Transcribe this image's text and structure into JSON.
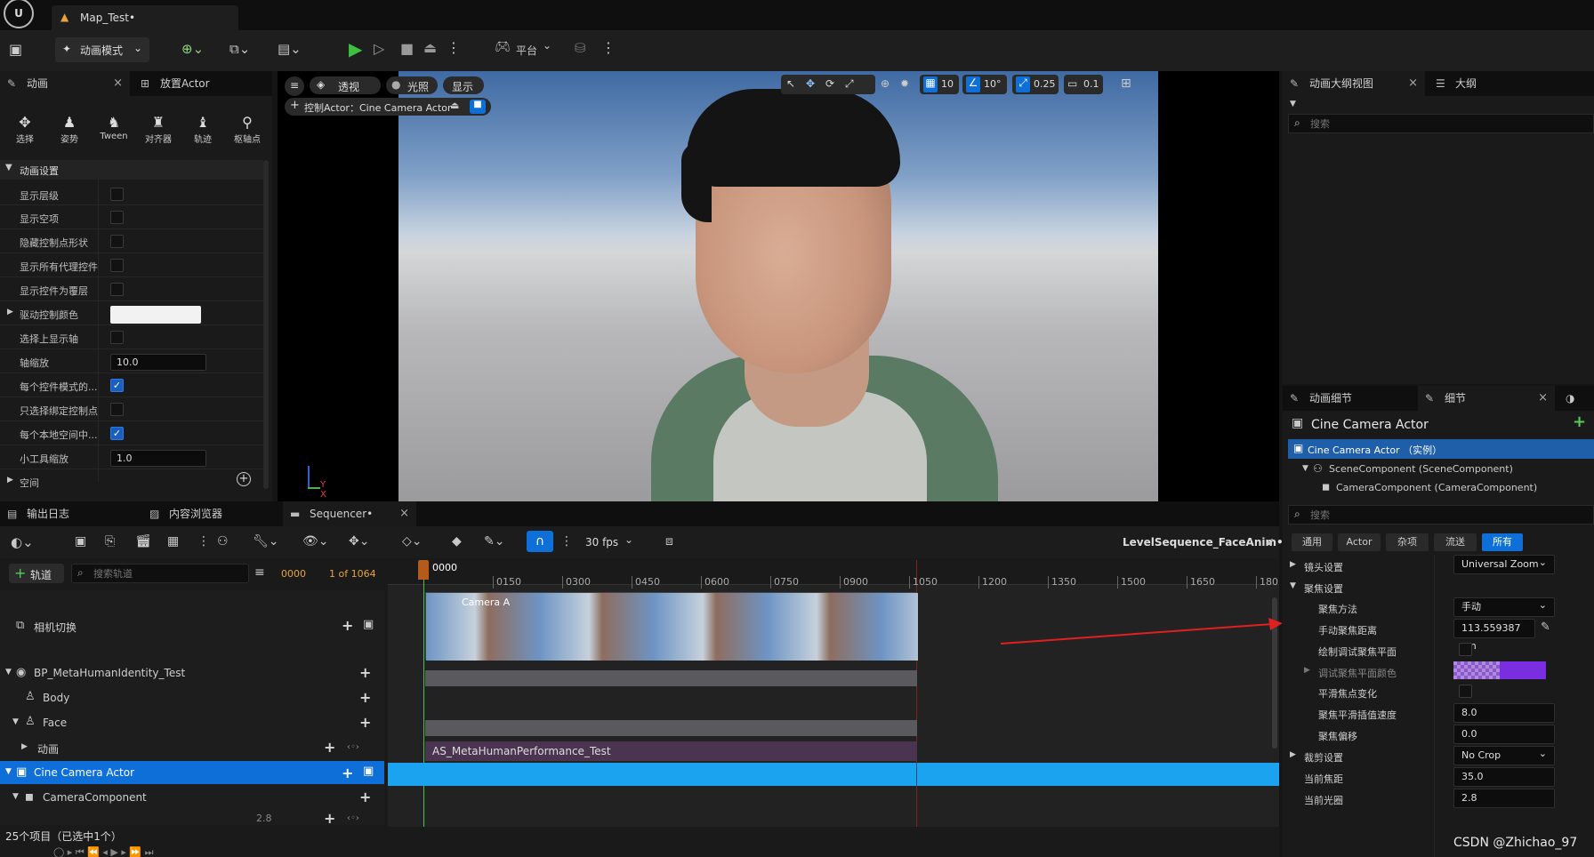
{
  "title_bar": {
    "map_tab": "Map_Test•"
  },
  "main_toolbar": {
    "mode_label": "动画模式",
    "platform_label": "平台"
  },
  "left_panel": {
    "tab_animation": "动画",
    "tab_place_actor": "放置Actor",
    "tools": [
      "选择",
      "姿势",
      "Tween",
      "对齐器",
      "轨迹",
      "枢轴点"
    ],
    "section_title": "动画设置",
    "rows": [
      {
        "label": "显示层级"
      },
      {
        "label": "显示空项"
      },
      {
        "label": "隐藏控制点形状"
      },
      {
        "label": "显示所有代理控件"
      },
      {
        "label": "显示控件为覆层"
      },
      {
        "label": "驱动控制颜色"
      },
      {
        "label": "选择上显示轴"
      },
      {
        "label": "轴缩放",
        "value": "10.0"
      },
      {
        "label": "每个控件模式的..."
      },
      {
        "label": "只选择绑定控制点"
      },
      {
        "label": "每个本地空间中..."
      },
      {
        "label": "小工具缩放",
        "value": "1.0"
      }
    ],
    "space_label": "空间"
  },
  "viewport": {
    "perspective": "透视",
    "lighting": "光照",
    "show": "显示",
    "pilot_label": "控制Actor：Cine Camera Actor",
    "grid": "10",
    "angle": "10°",
    "scale": "0.25",
    "camera_speed": "0.1"
  },
  "bottom_tabs": {
    "output_log": "输出日志",
    "content_browser": "内容浏览器",
    "sequencer": "Sequencer•"
  },
  "sequencer": {
    "fps": "30 fps",
    "sequence_name": "LevelSequence_FaceAnim•",
    "add_track": "轨道",
    "search_placeholder": "搜索轨道",
    "current_frame": "0000",
    "frame_count": "1 of 1064",
    "playhead_frame": "0000",
    "ticks": [
      "0150",
      "0300",
      "0450",
      "0600",
      "0750",
      "0900",
      "1050",
      "1200",
      "1350",
      "1500",
      "1650",
      "180"
    ],
    "tracks": [
      {
        "label": "相机切换"
      },
      {
        "label": "BP_MetaHumanIdentity_Test"
      },
      {
        "label": "Body"
      },
      {
        "label": "Face"
      },
      {
        "label": "动画"
      },
      {
        "label": "Cine Camera Actor"
      },
      {
        "label": "CameraComponent"
      }
    ],
    "aperture_partial": "2.8",
    "camera_clip_label": "Camera A",
    "anim_clip_label": "AS_MetaHumanPerformance_Test",
    "item_count": "25个项目（已选中1个）"
  },
  "outliner": {
    "tab_anim_outline": "动画大纲视图",
    "tab_outline": "大纲",
    "search_placeholder": "搜索"
  },
  "details": {
    "tab_anim_details": "动画细节",
    "tab_details": "细节",
    "actor_title": "Cine Camera Actor",
    "instance_label": "Cine Camera Actor （实例）",
    "component_scene": "SceneComponent (SceneComponent)",
    "component_camera": "CameraComponent (CameraComponent)",
    "search_placeholder": "搜索",
    "filters": [
      "通用",
      "Actor",
      "杂项",
      "流送",
      "所有"
    ],
    "lens_settings": "镜头设置",
    "lens_value": "Universal Zoom",
    "focus_settings": "聚焦设置",
    "focus_method": "聚焦方法",
    "focus_method_value": "手动",
    "manual_focus_distance": "手动聚焦距离",
    "manual_focus_value": "113.559387 cm",
    "draw_debug_plane": "绘制调试聚焦平面",
    "debug_plane_color": "调试聚焦平面颜色",
    "smooth_focus": "平滑焦点变化",
    "smooth_speed": "聚焦平滑插值速度",
    "smooth_speed_value": "8.0",
    "focus_offset": "聚焦偏移",
    "focus_offset_value": "0.0",
    "crop_settings": "裁剪设置",
    "crop_value": "No Crop",
    "current_focal": "当前焦距",
    "current_focal_value": "35.0",
    "current_aperture": "当前光圈",
    "current_aperture_value": "2.8"
  },
  "watermark": "CSDN @Zhichao_97",
  "colors": {
    "accent_blue": "#0e6fd8",
    "selection_blue": "#1ba3f0",
    "play_green": "#3fbf3f",
    "anim_clip": "#4a3450",
    "debug_color": "#7b2ee0"
  }
}
